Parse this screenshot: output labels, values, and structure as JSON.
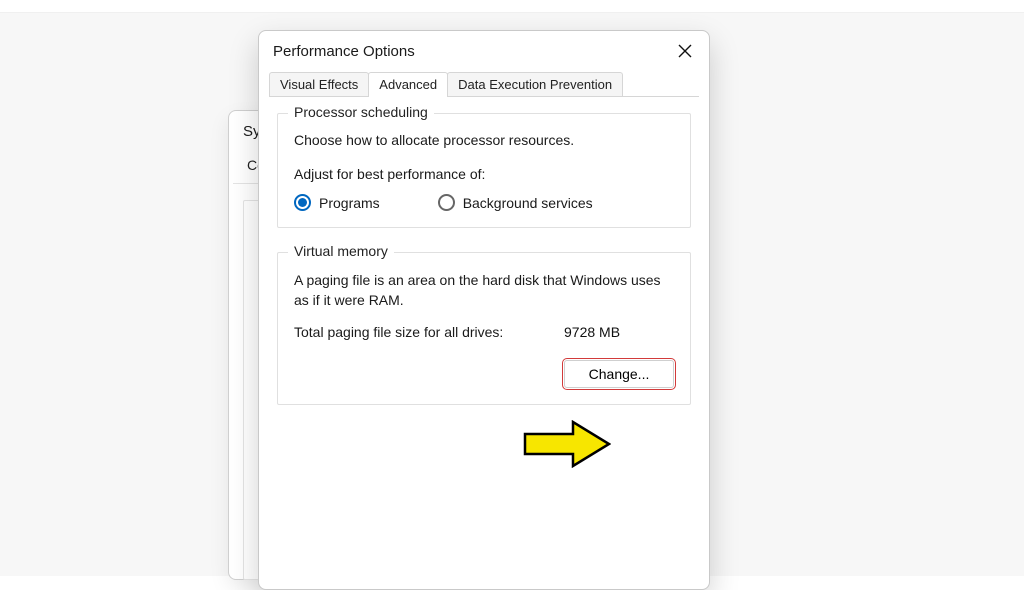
{
  "back_dialog": {
    "title_prefix": "Sys",
    "breadcrumb_prefix": "Co"
  },
  "dialog": {
    "title": "Performance Options",
    "tabs": [
      {
        "label": "Visual Effects",
        "active": false
      },
      {
        "label": "Advanced",
        "active": true
      },
      {
        "label": "Data Execution Prevention",
        "active": false
      }
    ],
    "processor": {
      "legend": "Processor scheduling",
      "desc": "Choose how to allocate processor resources.",
      "adjust_label": "Adjust for best performance of:",
      "options": [
        {
          "label": "Programs",
          "selected": true
        },
        {
          "label": "Background services",
          "selected": false
        }
      ]
    },
    "virtual_memory": {
      "legend": "Virtual memory",
      "desc": "A paging file is an area on the hard disk that Windows uses as if it were RAM.",
      "total_label": "Total paging file size for all drives:",
      "total_value": "9728 MB",
      "change_label": "Change..."
    }
  },
  "annotation": {
    "arrow_fill": "#f7e600",
    "arrow_stroke": "#000000",
    "highlight_stroke": "#d23a3a"
  }
}
